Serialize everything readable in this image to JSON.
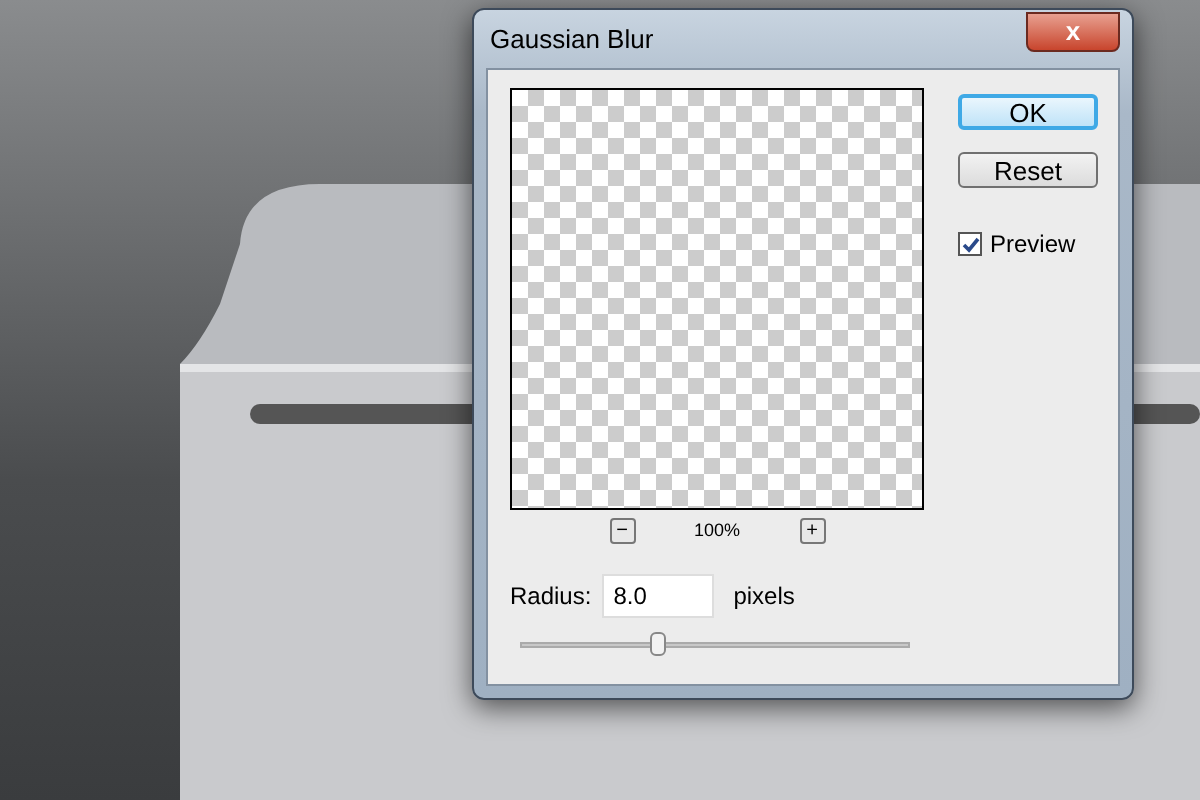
{
  "window": {
    "title": "Gaussian Blur",
    "close": "x"
  },
  "buttons": [
    {
      "label": "OK",
      "default": true
    },
    {
      "label": "Reset",
      "default": false
    }
  ],
  "preview_option": {
    "label": "Preview",
    "checked": true
  },
  "zoom": {
    "minus": "−",
    "value": "100%",
    "plus": "+"
  },
  "radius": {
    "label": "Radius:",
    "value": "8.0",
    "unit": "pixels"
  },
  "slider": {
    "level": 0.35
  }
}
